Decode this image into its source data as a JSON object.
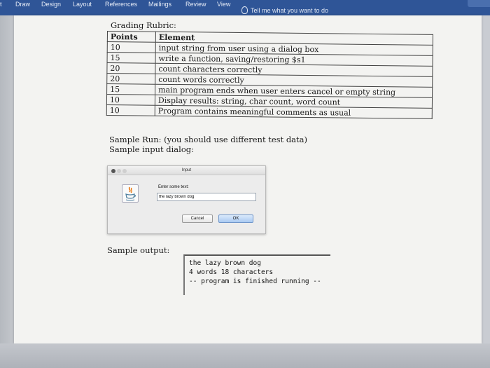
{
  "ribbon": {
    "tabs": [
      "Draw",
      "Design",
      "Layout",
      "References",
      "Mailings",
      "Review",
      "View"
    ],
    "tell_me": "Tell me what you want to do",
    "color": "#2f5597"
  },
  "rubric": {
    "title": "Grading Rubric:",
    "headers": [
      "Points",
      "Element"
    ],
    "rows": [
      [
        "10",
        "input string from user using a dialog box"
      ],
      [
        "15",
        "write a function, saving/restoring $s1"
      ],
      [
        "20",
        "count characters correctly"
      ],
      [
        "20",
        "count words correctly"
      ],
      [
        "15",
        "main program ends when user enters cancel or empty string"
      ],
      [
        "10",
        "Display results: string, char count, word count"
      ],
      [
        "10",
        "Program contains meaningful comments as usual"
      ]
    ]
  },
  "sample": {
    "run_line": "Sample Run: (you should use different test data)",
    "input_line": "Sample input dialog:"
  },
  "dialog": {
    "title": "Input",
    "prompt": "Enter some text:",
    "value": "the lazy brown dog",
    "cancel": "Cancel",
    "ok": "OK",
    "icon": "java-icon"
  },
  "output": {
    "label": "Sample output:",
    "lines": [
      "the lazy brown dog",
      "4 words 18 characters",
      "-- program is finished running --"
    ]
  }
}
